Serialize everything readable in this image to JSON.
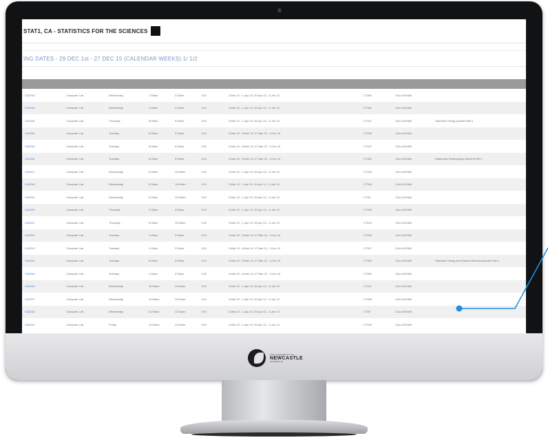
{
  "screen": {
    "title": "STAT1, CA - STATISTICS FOR THE SCIENCES",
    "dates_line": "ING DATES - 29 DEC 1st - 27 DEC 15 (CALENDAR WEEKS) 1/ 1/2",
    "columns": [
      "",
      "",
      "",
      "",
      "",
      "",
      "",
      "",
      "",
      ""
    ],
    "rows": [
      {
        "activity": "CA2016",
        "type": "Computer Lab",
        "day": "Wednesday",
        "start": "1:00am",
        "end": "2:00am",
        "duration": "1:00",
        "weeks": "3-Mar 13 - 1-Apr 13, 26-Apr 13 - 3-Jun 13",
        "room": "CT304",
        "campus": "CALLAGHAN",
        "comments": ""
      },
      {
        "activity": "CA2016",
        "type": "Computer Lab",
        "day": "Wednesday",
        "start": "1:00am",
        "end": "2:00am",
        "duration": "1:00",
        "weeks": "3-Mar 13 - 1-Apr 13, 26-Apr 13 - 3-Jun 13",
        "room": "CT304",
        "campus": "CALLAGHAN",
        "comments": ""
      },
      {
        "activity": "CA2016",
        "type": "Computer Lab",
        "day": "Thursday",
        "start": "8:00am",
        "end": "9:00am",
        "duration": "1:00",
        "weeks": "3-Mar 13 - 1-Apr 13, 26-Apr 13 - 3-Jun 13",
        "room": "CT101",
        "campus": "CALLAGHAN",
        "comments": "Standard Timing (student 3M+)"
      },
      {
        "activity": "CA2016",
        "type": "Computer Lab",
        "day": "Tuesday",
        "start": "8:00am",
        "end": "9:00am",
        "duration": "1:00",
        "weeks": "3-Mar 13 - 8-Mar 13, 27-Mar 13 - 3-Jun 13",
        "room": "CT206",
        "campus": "CALLAGHAN",
        "comments": ""
      },
      {
        "activity": "CA2016",
        "type": "Computer Lab",
        "day": "Tuesday",
        "start": "8:00am",
        "end": "9:00am",
        "duration": "1:00",
        "weeks": "3-Mar 13 - 8-Mar 13, 27-Mar 13 - 3-Jun 13",
        "room": "CT107",
        "campus": "CALLAGHAN",
        "comments": ""
      },
      {
        "activity": "CA2016",
        "type": "Computer Lab",
        "day": "Tuesday",
        "start": "8:00am",
        "end": "9:00am",
        "duration": "1:00",
        "weeks": "3-Mar 13 - 8-Mar 13, 27-Mar 13 - 3-Jun 13",
        "room": "CT304",
        "campus": "CALLAGHAN",
        "comments": "Diagnostic Radiography (student 3M+)"
      },
      {
        "activity": "CA2017",
        "type": "Computer Lab",
        "day": "Wednesday",
        "start": "9:00am",
        "end": "10:00am",
        "duration": "1:00",
        "weeks": "3-Mar 13 - 1-Apr 13, 26-Apr 13 - 3-Jun 13",
        "room": "CT206",
        "campus": "CALLAGHAN",
        "comments": ""
      },
      {
        "activity": "CA2018",
        "type": "Computer Lab",
        "day": "Wednesday",
        "start": "9:00am",
        "end": "10:00am",
        "duration": "1:00",
        "weeks": "3-Mar 13 - 1-Apr 13, 26-Apr 13 - 3-Jun 13",
        "room": "CT304",
        "campus": "CALLAGHAN",
        "comments": ""
      },
      {
        "activity": "CA2019",
        "type": "Computer Lab",
        "day": "Wednesday",
        "start": "9:00am",
        "end": "10:00am",
        "duration": "1:00",
        "weeks": "3-Mar 13 - 1-Apr 13, 26-Apr 13 - 3-Jun 13",
        "room": "CT05",
        "campus": "CALLAGHAN",
        "comments": ""
      },
      {
        "activity": "CA2019",
        "type": "Computer Lab",
        "day": "Thursday",
        "start": "2:00pm",
        "end": "3:00pm",
        "duration": "1:00",
        "weeks": "3-Mar 13 - 1-Apr 13, 26-Apr 13 - 3-Jun 13",
        "room": "CT105",
        "campus": "CALLAGHAN",
        "comments": ""
      },
      {
        "activity": "CA2011",
        "type": "Computer Lab",
        "day": "Thursday",
        "start": "9:00am",
        "end": "10:00am",
        "duration": "1:00",
        "weeks": "3-Mar 13 - 1-Apr 13, 26-Apr 13 - 3-Jun 13",
        "room": "CT613",
        "campus": "CALLAGHAN",
        "comments": ""
      },
      {
        "activity": "CA2012",
        "type": "Computer Lab",
        "day": "Tuesday",
        "start": "1:00pm",
        "end": "2:00pm",
        "duration": "1:00",
        "weeks": "3-Mar 13 - 8-Mar 13, 27-Mar 13 - 3-Jun 13",
        "room": "CT206",
        "campus": "CALLAGHAN",
        "comments": ""
      },
      {
        "activity": "CA2013",
        "type": "Computer Lab",
        "day": "Tuesday",
        "start": "1:00pm",
        "end": "2:00pm",
        "duration": "1:00",
        "weeks": "3-Mar 13 - 8-Mar 13, 27-Mar 13 - 3-Jun 13",
        "room": "CT107",
        "campus": "CALLAGHAN",
        "comments": ""
      },
      {
        "activity": "CA2013",
        "type": "Computer Lab",
        "day": "Tuesday",
        "start": "8:00am",
        "end": "9:00am",
        "duration": "1:00",
        "weeks": "3-Mar 13 - 8-Mar 13, 27-Mar 13 - 3-Jun 13",
        "room": "CT304",
        "campus": "CALLAGHAN",
        "comments": "Standard Timing and Student Medical (student 3M+)"
      },
      {
        "activity": "CA2015",
        "type": "Computer Lab",
        "day": "Tuesday",
        "start": "1:00pm",
        "end": "2:00pm",
        "duration": "1:00",
        "weeks": "3-Mar 13 - 8-Mar 13, 27-Mar 13 - 3-Jun 13",
        "room": "CT304",
        "campus": "CALLAGHAN",
        "comments": ""
      },
      {
        "activity": "CA2016",
        "type": "Computer Lab",
        "day": "Wednesday",
        "start": "10:00am",
        "end": "11:00am",
        "duration": "1:00",
        "weeks": "3-Mar 13 - 1-Apr 13, 26-Apr 13 - 3-Jun 13",
        "room": "CT411",
        "campus": "CALLAGHAN",
        "comments": ""
      },
      {
        "activity": "CA2017",
        "type": "Computer Lab",
        "day": "Wednesday",
        "start": "10:00am",
        "end": "11:00am",
        "duration": "1:00",
        "weeks": "3-Mar 13 - 1-Apr 13, 26-Apr 13 - 3-Jun 13",
        "room": "CT206",
        "campus": "CALLAGHAN",
        "comments": ""
      },
      {
        "activity": "CA2018",
        "type": "Computer Lab",
        "day": "Wednesday",
        "start": "11:00am",
        "end": "12:00pm",
        "duration": "1:00",
        "weeks": "3-Mar 13 - 1-Apr 13, 26-Apr 13 - 3-Jun 13",
        "room": "CT05",
        "campus": "CALLAGHAN",
        "comments": ""
      },
      {
        "activity": "CA2019",
        "type": "Computer Lab",
        "day": "Friday",
        "start": "10:00am",
        "end": "11:00am",
        "duration": "1:00",
        "weeks": "3-Mar 13 - 1-Apr 13, 26-Apr 13 - 3-Jun 13",
        "room": "CT105",
        "campus": "CALLAGHAN",
        "comments": ""
      }
    ]
  },
  "monitor": {
    "logo_small": "THE UNIVERSITY OF",
    "logo_big": "NEWCASTLE",
    "logo_sub": "AUSTRALIA"
  },
  "colors": {
    "bezel": "#111214",
    "header_row": "#9a9a9a",
    "link_blue": "#3b7bd4",
    "dates_blue": "#7d97c2",
    "annotation_blue": "#1f8fe0"
  }
}
